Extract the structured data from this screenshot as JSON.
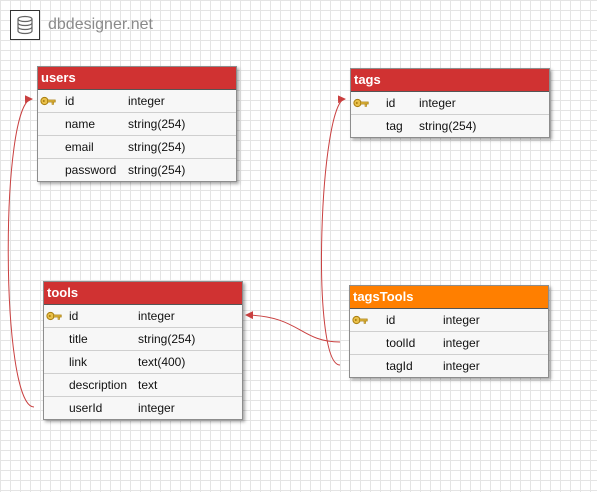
{
  "logo": {
    "text": "dbdesigner.net",
    "icon": "database-icon"
  },
  "colors": {
    "header_red": "#d03232",
    "header_orange": "#ff7f00",
    "link_line": "#c94040",
    "key_icon": "#d6a418"
  },
  "tables": {
    "users": {
      "name": "users",
      "rows": [
        {
          "name": "id",
          "type": "integer",
          "key": true
        },
        {
          "name": "name",
          "type": "string(254)",
          "key": false
        },
        {
          "name": "email",
          "type": "string(254)",
          "key": false
        },
        {
          "name": "password",
          "type": "string(254)",
          "key": false
        }
      ]
    },
    "tags": {
      "name": "tags",
      "rows": [
        {
          "name": "id",
          "type": "integer",
          "key": true
        },
        {
          "name": "tag",
          "type": "string(254)",
          "key": false
        }
      ]
    },
    "tools": {
      "name": "tools",
      "rows": [
        {
          "name": "id",
          "type": "integer",
          "key": true
        },
        {
          "name": "title",
          "type": "string(254)",
          "key": false
        },
        {
          "name": "link",
          "type": "text(400)",
          "key": false
        },
        {
          "name": "description",
          "type": "text",
          "key": false
        },
        {
          "name": "userId",
          "type": "integer",
          "key": false
        }
      ]
    },
    "tagsTools": {
      "name": "tagsTools",
      "rows": [
        {
          "name": "id",
          "type": "integer",
          "key": true
        },
        {
          "name": "toolId",
          "type": "integer",
          "key": false
        },
        {
          "name": "tagId",
          "type": "integer",
          "key": false
        }
      ]
    }
  }
}
